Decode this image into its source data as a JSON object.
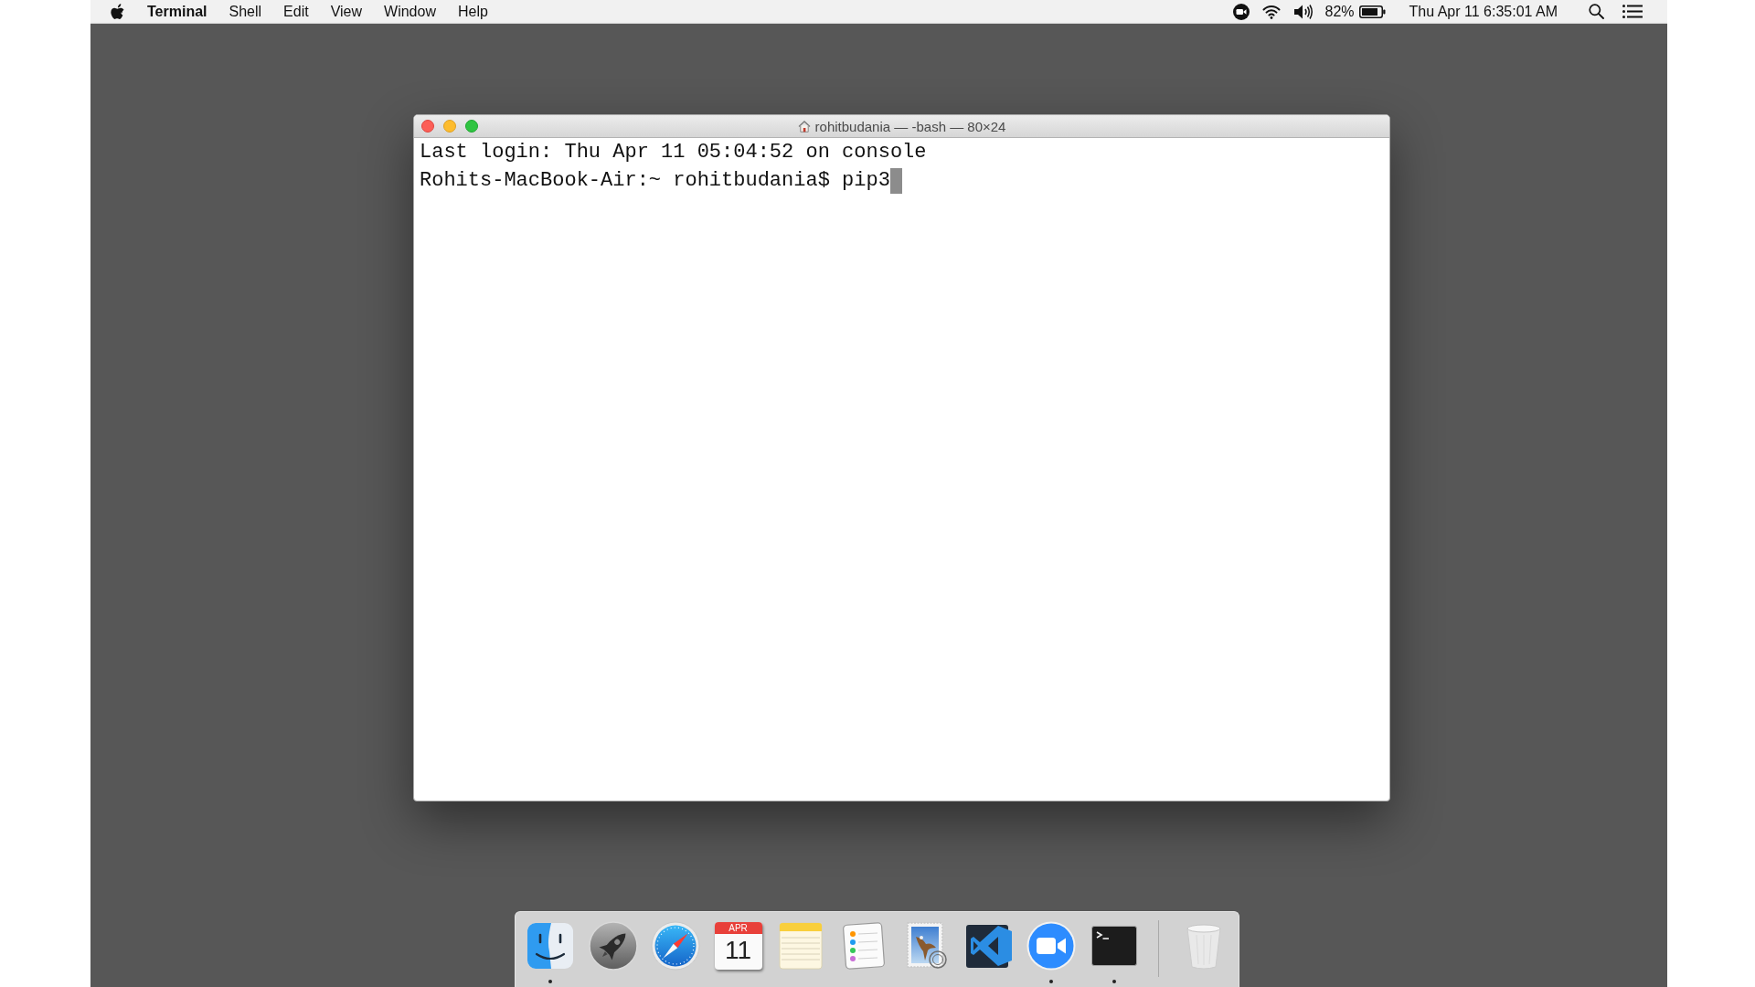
{
  "menu_bar": {
    "app_name": "Terminal",
    "menus": [
      "Shell",
      "Edit",
      "View",
      "Window",
      "Help"
    ],
    "battery": "82%",
    "clock": "Thu Apr 11 6:35:01 AM"
  },
  "window": {
    "title": "rohitbudania — -bash — 80×24",
    "lines": [
      "Last login: Thu Apr 11 05:04:52 on console",
      "Rohits-MacBook-Air:~ rohitbudania$ pip3"
    ]
  },
  "dock": {
    "items": [
      {
        "kind": "finder",
        "running": true
      },
      {
        "kind": "launchpad",
        "running": false
      },
      {
        "kind": "safari",
        "running": false
      },
      {
        "kind": "calendar",
        "running": false,
        "month": "APR",
        "day": "11"
      },
      {
        "kind": "notes",
        "running": false
      },
      {
        "kind": "reminders",
        "running": false
      },
      {
        "kind": "mail",
        "running": false
      },
      {
        "kind": "code",
        "running": false
      },
      {
        "kind": "zoom",
        "running": true
      },
      {
        "kind": "terminal",
        "running": true
      },
      {
        "kind": "trash",
        "running": false
      }
    ]
  }
}
